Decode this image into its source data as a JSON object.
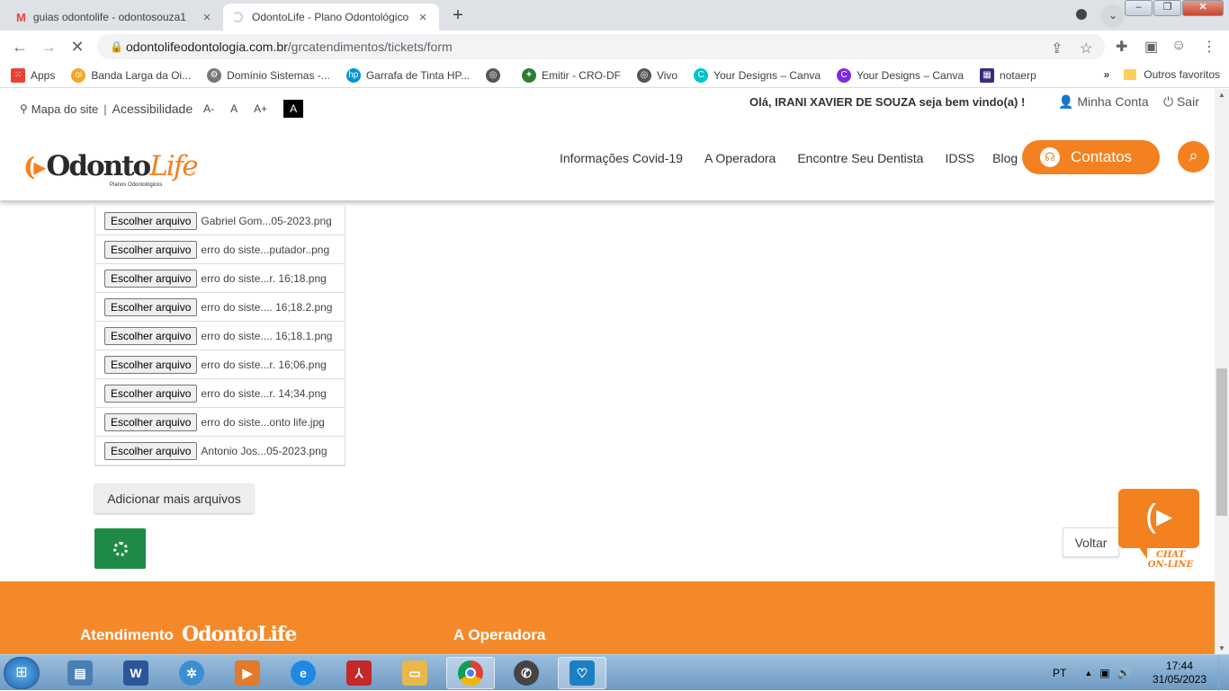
{
  "browser": {
    "tabs": [
      {
        "label": "guias odontolife - odontosouza1",
        "icon": "gmail-icon"
      },
      {
        "label": "OdontoLife - Plano Odontológico",
        "icon": "loading-icon"
      }
    ],
    "url_host": "odontolifeodontologia.com.br",
    "url_path": "/grcatendimentos/tickets/form",
    "bookmarks": [
      {
        "label": "Apps",
        "icon": "apps-grid-icon",
        "color": "#ea4335"
      },
      {
        "label": "Banda Larga da Oi...",
        "icon": "oi-icon",
        "color": "#f5a623"
      },
      {
        "label": "Domínio Sistemas -...",
        "icon": "gear-icon",
        "color": "#777777"
      },
      {
        "label": "Garrafa de Tinta HP...",
        "icon": "hp-icon",
        "color": "#0096d6"
      },
      {
        "label": "",
        "icon": "globe-icon",
        "color": "#555555"
      },
      {
        "label": "Emitir - CRO-DF",
        "icon": "cro-icon",
        "color": "#2e7d32"
      },
      {
        "label": "Vivo",
        "icon": "globe-icon",
        "color": "#555555"
      },
      {
        "label": "Your Designs – Canva",
        "icon": "canva-icon",
        "color": "#00c4cc"
      },
      {
        "label": "Your Designs – Canva",
        "icon": "canva-icon",
        "color": "#7d2ae8"
      },
      {
        "label": "notaerp",
        "icon": "notaerp-icon",
        "color": "#3b2a7a"
      }
    ],
    "bookmarks_overflow": "»",
    "other_bookmarks": "Outros favoritos"
  },
  "site": {
    "util": {
      "sitemap": "Mapa do site",
      "accessibility": "Acessibilidade",
      "font_decrease": "A-",
      "font_normal": "A",
      "font_increase": "A+",
      "contrast": "A"
    },
    "greeting": "Olá, IRANI XAVIER DE SOUZA seja bem vindo(a) !",
    "account": "Minha Conta",
    "logout": "Sair",
    "logo_text_a": "Odonto",
    "logo_text_b": "Life",
    "logo_sub": "Planos Odontológicos",
    "nav": [
      "Informações Covid-19",
      "A Operadora",
      "Encontre Seu Dentista",
      "IDSS",
      "Blog"
    ],
    "contact_button": "Contatos"
  },
  "form": {
    "file_button_label": "Escolher arquivo",
    "files": [
      "Gabriel Gom...05-2023.png",
      "erro do siste...putador..png",
      "erro do siste...r. 16;18.png",
      "erro do siste.... 16;18.2.png",
      "erro do siste.... 16;18.1.png",
      "erro do siste...r. 16;06.png",
      "erro do siste...r. 14;34.png",
      "erro do siste...onto life.jpg",
      "Antonio Jos...05-2023.png"
    ],
    "add_more": "Adicionar mais arquivos",
    "back": "Voltar"
  },
  "chat": {
    "line1": "CHAT",
    "line2": "ON-LINE"
  },
  "footer": {
    "atendimento": "Atendimento",
    "logo": "OdontoLife",
    "operadora": "A Operadora"
  },
  "taskbar": {
    "apps": [
      {
        "name": "explorer-icon",
        "color": "#4a7fb5"
      },
      {
        "name": "word-icon",
        "color": "#2b579a"
      },
      {
        "name": "chrome-remote-icon",
        "color": "#3a8fd0"
      },
      {
        "name": "media-player-icon",
        "color": "#e27a2a"
      },
      {
        "name": "ie-icon",
        "color": "#1e88e5"
      },
      {
        "name": "acrobat-icon",
        "color": "#c62828"
      },
      {
        "name": "folder-icon",
        "color": "#e8b84a"
      },
      {
        "name": "chrome-icon",
        "color": "#db4437"
      },
      {
        "name": "whatsapp-icon",
        "color": "#444444"
      },
      {
        "name": "health-app-icon",
        "color": "#1d7fc3"
      }
    ],
    "lang": "PT",
    "time": "17:44",
    "date": "31/05/2023"
  },
  "colors": {
    "brand_orange": "#f48120",
    "send_green": "#1f8a47"
  }
}
